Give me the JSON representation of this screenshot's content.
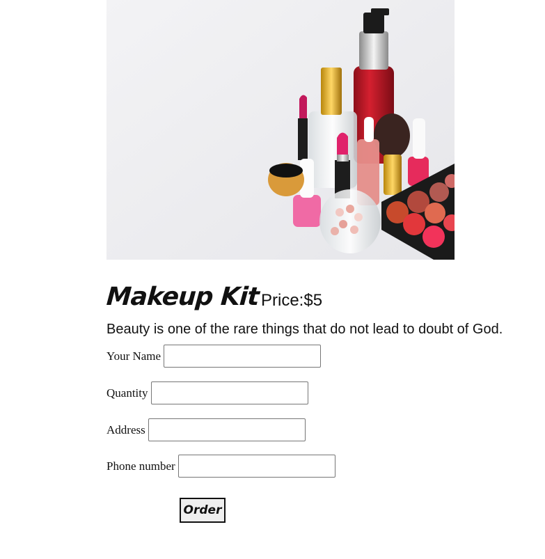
{
  "product": {
    "title": "Makeup Kit",
    "price": "Price:$5",
    "tagline": "Beauty is one of the rare things that do not lead to doubt of God."
  },
  "form": {
    "name_label": "Your Name",
    "name_value": "",
    "quantity_label": "Quantity",
    "quantity_value": "",
    "address_label": "Address",
    "address_value": "",
    "phone_label": "Phone number",
    "phone_value": "",
    "submit_label": "Order"
  },
  "colors": {
    "background": "#ffffff",
    "text": "#111111",
    "button_bg": "#efefef"
  }
}
